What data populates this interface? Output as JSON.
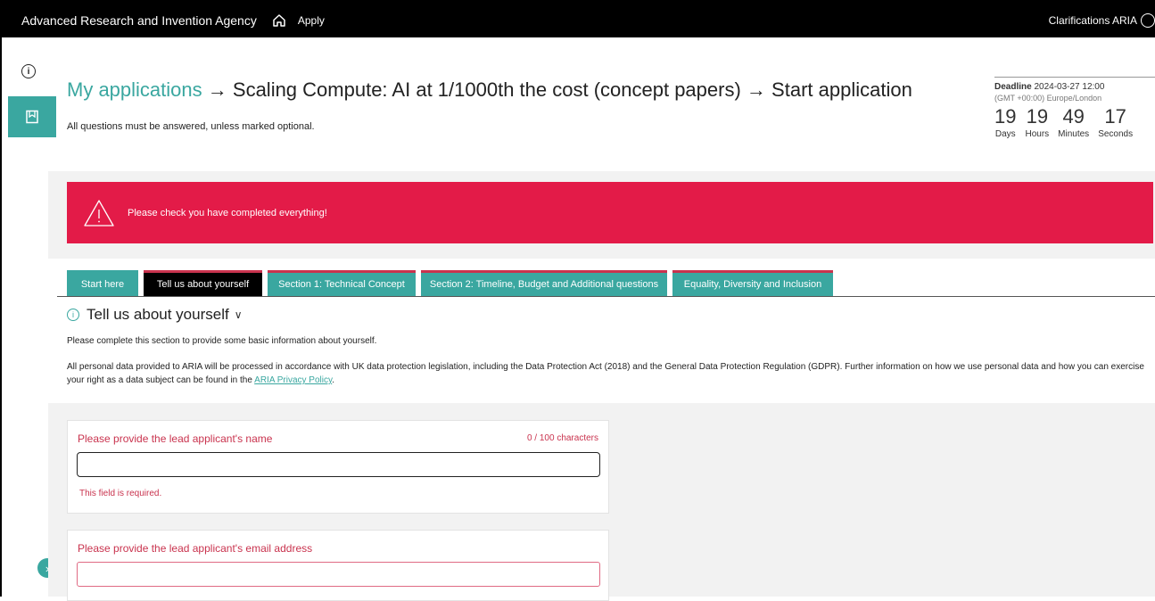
{
  "topbar": {
    "brand": "Advanced Research and Invention Agency",
    "apply": "Apply",
    "clarifications": "Clarifications ARIA"
  },
  "header": {
    "crumb_applications": "My applications",
    "crumb_sep": "→",
    "crumb_call": "Scaling Compute: AI at 1/1000th the cost (concept papers)",
    "crumb_current": "Start application",
    "note": "All questions must be answered, unless marked optional."
  },
  "deadline": {
    "label": "Deadline",
    "datetime": "2024-03-27 12:00",
    "timezone": "(GMT +00:00) Europe/London",
    "countdown": [
      {
        "value": "19",
        "unit": "Days"
      },
      {
        "value": "19",
        "unit": "Hours"
      },
      {
        "value": "49",
        "unit": "Minutes"
      },
      {
        "value": "17",
        "unit": "Seconds"
      }
    ]
  },
  "alert": {
    "message": "Please check you have completed everything!"
  },
  "tabs": [
    {
      "label": "Start here"
    },
    {
      "label": "Tell us about yourself"
    },
    {
      "label": "Section 1: Technical Concept"
    },
    {
      "label": "Section 2: Timeline, Budget and Additional questions"
    },
    {
      "label": "Equality, Diversity and Inclusion"
    }
  ],
  "section": {
    "title": "Tell us about yourself",
    "intro": "Please complete this section to provide some basic information about yourself.",
    "privacy_text": "All personal data provided to ARIA will be processed in accordance with UK data protection legislation, including the Data Protection Act (2018) and the General Data Protection Regulation (GDPR). Further information on how we use personal data and how you can exercise your right as a data subject can be found in the",
    "privacy_link": "ARIA Privacy Policy",
    "privacy_end": "."
  },
  "form": {
    "name_label": "Please provide the lead applicant's name",
    "name_count": "0 / 100 characters",
    "name_value": "",
    "name_error": "This field is required.",
    "email_label": "Please provide the lead applicant's email address",
    "email_value": ""
  },
  "colors": {
    "accent": "#3aa7a0",
    "alert": "#e31b48",
    "error": "#c9334e"
  }
}
